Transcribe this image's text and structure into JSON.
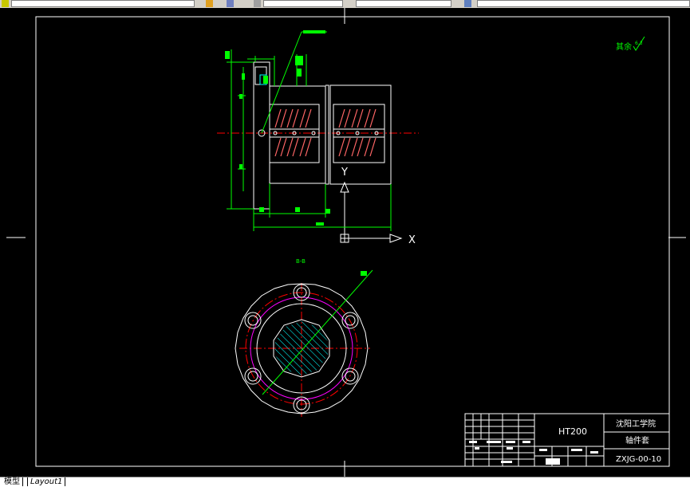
{
  "tabs": {
    "model": "模型",
    "layout1": "Layout1"
  },
  "drawing": {
    "surface_note": "其余",
    "roughness_value": "6.3",
    "section_label": "B-B",
    "axis_x": "X",
    "axis_y": "Y"
  },
  "title_block": {
    "material": "HT200",
    "school": "沈阳工学院",
    "part_name": "轴件套",
    "drawing_number": "ZXJG-00-10"
  },
  "colors": {
    "background": "#000000",
    "border": "#ffffff",
    "dimension": "#00ff00",
    "center": "#ff0000",
    "hidden": "#ff00ff",
    "hatch": "#00ffff"
  }
}
